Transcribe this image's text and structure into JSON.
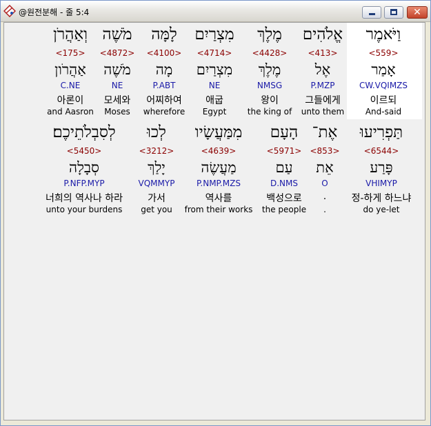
{
  "window": {
    "title": "@원전분해 - 줄 5:4",
    "icon": "app-diamond-icon"
  },
  "colors": {
    "strong": "#8b0000",
    "morph": "#1a1aa8",
    "highlight": "#ffffff"
  },
  "row1": [
    {
      "word": "וַיֹּאמֶר",
      "strong": "<559>",
      "lemma": "אָמַר",
      "morph": "CW.VQIMZS",
      "korean": "이르되",
      "english": "And-said",
      "highlighted": true
    },
    {
      "word": "אֱלֹהִים",
      "strong": "<413>",
      "lemma": "אֶל",
      "morph": "P.MZP",
      "korean": "그들에게",
      "english": "unto them",
      "highlighted": false
    },
    {
      "word": "מֶלֶךְ",
      "strong": "<4428>",
      "lemma": "מֶלֶךְ",
      "morph": "NMSG",
      "korean": "왕이",
      "english": "the king of",
      "highlighted": false
    },
    {
      "word": "מִצְרַיִם",
      "strong": "<4714>",
      "lemma": "מִצְרַיִם",
      "morph": "NE",
      "korean": "애굽",
      "english": "Egypt",
      "highlighted": false
    },
    {
      "word": "לָמָּה",
      "strong": "<4100>",
      "lemma": "מָה",
      "morph": "P.ABT",
      "korean": "어찌하여",
      "english": "wherefore",
      "highlighted": false
    },
    {
      "word": "מֹשֶׁה",
      "strong": "<4872>",
      "lemma": "מֹשֶׁה",
      "morph": "NE",
      "korean": "모세와",
      "english": "Moses",
      "highlighted": false
    },
    {
      "word": "וְאַהֲרֹן",
      "strong": "<175>",
      "lemma": "אַהֲרֹון",
      "morph": "C.NE",
      "korean": "아론이",
      "english": "and Aasron",
      "highlighted": false
    }
  ],
  "row2": [
    {
      "word": "תַּפְרִיעוּ",
      "strong": "<6544>",
      "lemma": "פָּרַע",
      "morph": "VHIMYP",
      "korean": "정-하게 하느냐",
      "english": "do ye-let"
    },
    {
      "word": "אֶת־",
      "strong": "<853>",
      "lemma": "אֵת",
      "morph": "O",
      "korean": ".",
      "english": "."
    },
    {
      "word": "הָעָם",
      "strong": "<5971>",
      "lemma": "עַם",
      "morph": "D.NMS",
      "korean": "백성으로",
      "english": "the people"
    },
    {
      "word": "מִמַּעֲשָׂיו",
      "strong": "<4639>",
      "lemma": "מַעֲשֶׂה",
      "morph": "P.NMP.MZS",
      "korean": "역사를",
      "english": "from their works"
    },
    {
      "word": "לְכוּ",
      "strong": "<3212>",
      "lemma": "יָלַךְ",
      "morph": "VQMMYP",
      "korean": "가서",
      "english": "get you"
    },
    {
      "word": "לְסִבְלֹתֵיכֶם׃",
      "strong": "<5450>",
      "lemma": "סְבָלָה",
      "morph": "P.NFP.MYP",
      "korean": "너희의 역사나 하라",
      "english": "unto your burdens"
    }
  ]
}
